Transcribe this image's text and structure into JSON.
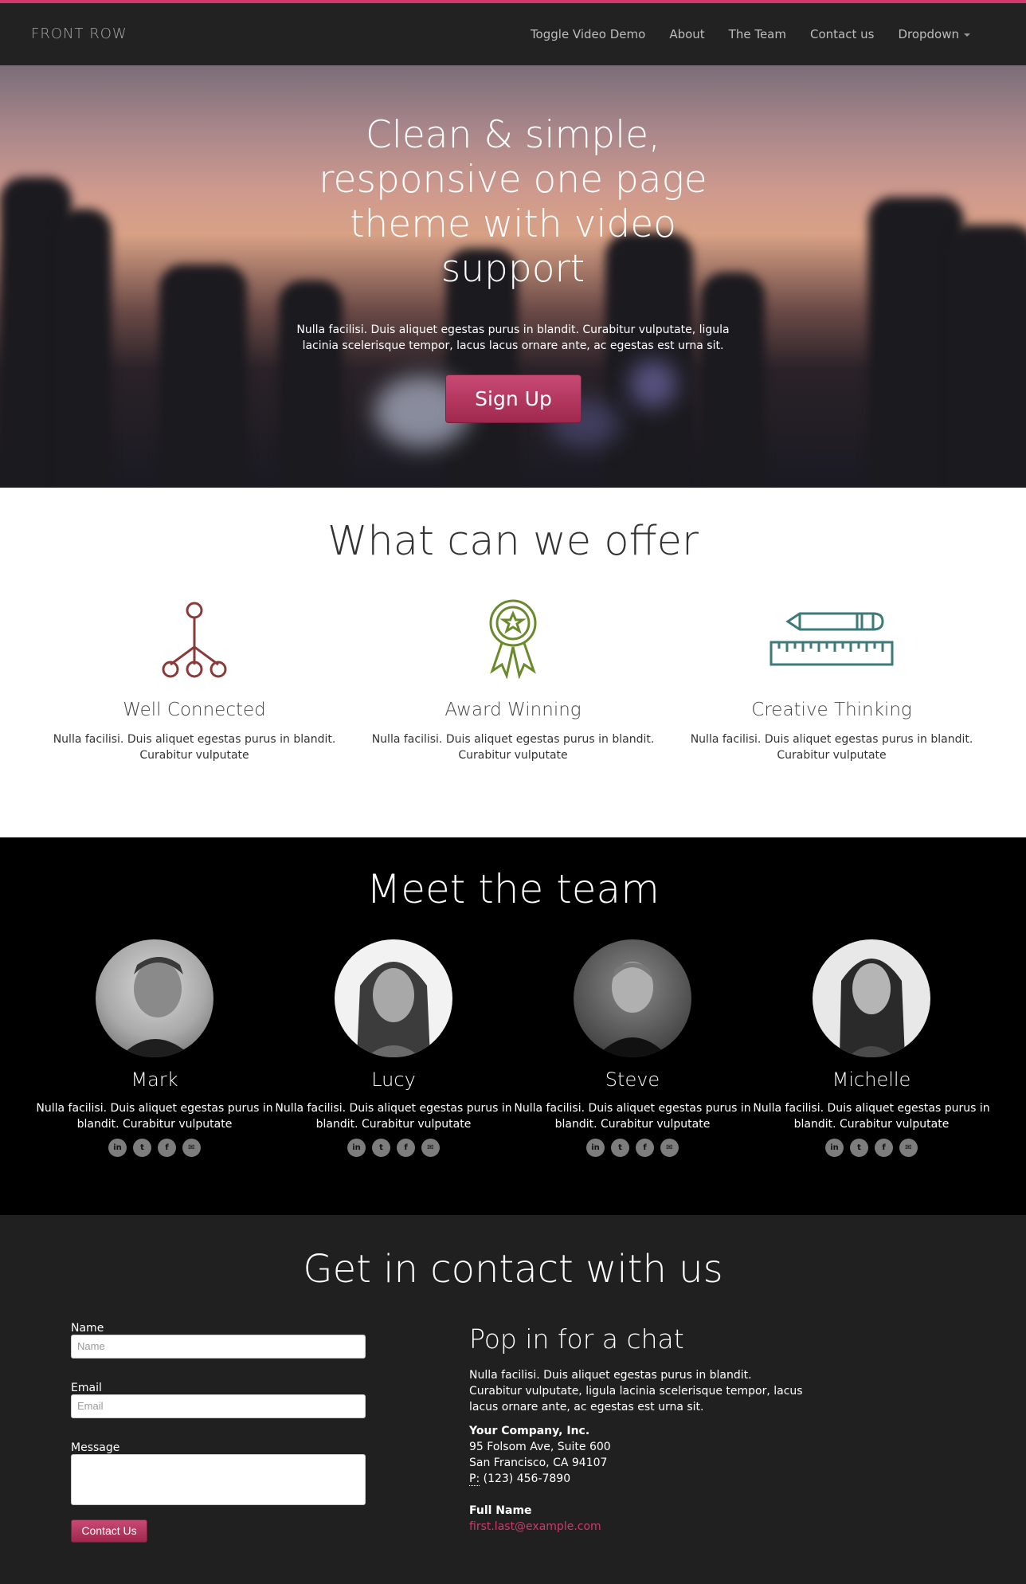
{
  "nav": {
    "brand": "FRONT ROW",
    "items": [
      "Toggle Video Demo",
      "About",
      "The Team",
      "Contact us",
      "Dropdown"
    ]
  },
  "hero": {
    "title": "Clean & simple, responsive one page theme with video support",
    "text": "Nulla facilisi. Duis aliquet egestas purus in blandit. Curabitur vulputate, ligula lacinia scelerisque tempor, lacus lacus ornare ante, ac egestas est urna sit.",
    "button": "Sign Up"
  },
  "offer": {
    "title": "What can we offer",
    "features": [
      {
        "icon": "network-icon",
        "title": "Well Connected",
        "text": "Nulla facilisi. Duis aliquet egestas purus in blandit. Curabitur vulputate",
        "color": "#8b3a3a"
      },
      {
        "icon": "award-ribbon-icon",
        "title": "Award Winning",
        "text": "Nulla facilisi. Duis aliquet egestas purus in blandit. Curabitur vulputate",
        "color": "#6a8a2c"
      },
      {
        "icon": "pencil-ruler-icon",
        "title": "Creative Thinking",
        "text": "Nulla facilisi. Duis aliquet egestas purus in blandit. Curabitur vulputate",
        "color": "#3d7a7a"
      }
    ]
  },
  "team": {
    "title": "Meet the team",
    "members": [
      {
        "name": "Mark",
        "text": "Nulla facilisi. Duis aliquet egestas purus in blandit. Curabitur vulputate"
      },
      {
        "name": "Lucy",
        "text": "Nulla facilisi. Duis aliquet egestas purus in blandit. Curabitur vulputate"
      },
      {
        "name": "Steve",
        "text": "Nulla facilisi. Duis aliquet egestas purus in blandit. Curabitur vulputate"
      },
      {
        "name": "Michelle",
        "text": "Nulla facilisi. Duis aliquet egestas purus in blandit. Curabitur vulputate"
      }
    ],
    "social_icons": [
      "linkedin-icon",
      "twitter-icon",
      "facebook-icon",
      "mail-icon"
    ],
    "social_glyphs": [
      "in",
      "t",
      "f",
      "✉"
    ]
  },
  "contact": {
    "title": "Get in contact with us",
    "name_label": "Name",
    "name_placeholder": "Name",
    "email_label": "Email",
    "email_placeholder": "Email",
    "message_label": "Message",
    "button": "Contact Us",
    "info_title": "Pop in for a chat",
    "info_text": "Nulla facilisi. Duis aliquet egestas purus in blandit. Curabitur vulputate, ligula lacinia scelerisque tempor, lacus lacus ornare ante, ac egestas est urna sit.",
    "company": "Your Company, Inc.",
    "address1": "95 Folsom Ave, Suite 600",
    "address2": "San Francisco, CA 94107",
    "phone_abbr": "P:",
    "phone": "(123) 456-7890",
    "full_name": "Full Name",
    "email": "first.last@example.com"
  },
  "colors": {
    "accent": "#d2386c",
    "nav_bg": "#222222",
    "team_bg": "#000000",
    "contact_bg": "#202020"
  }
}
